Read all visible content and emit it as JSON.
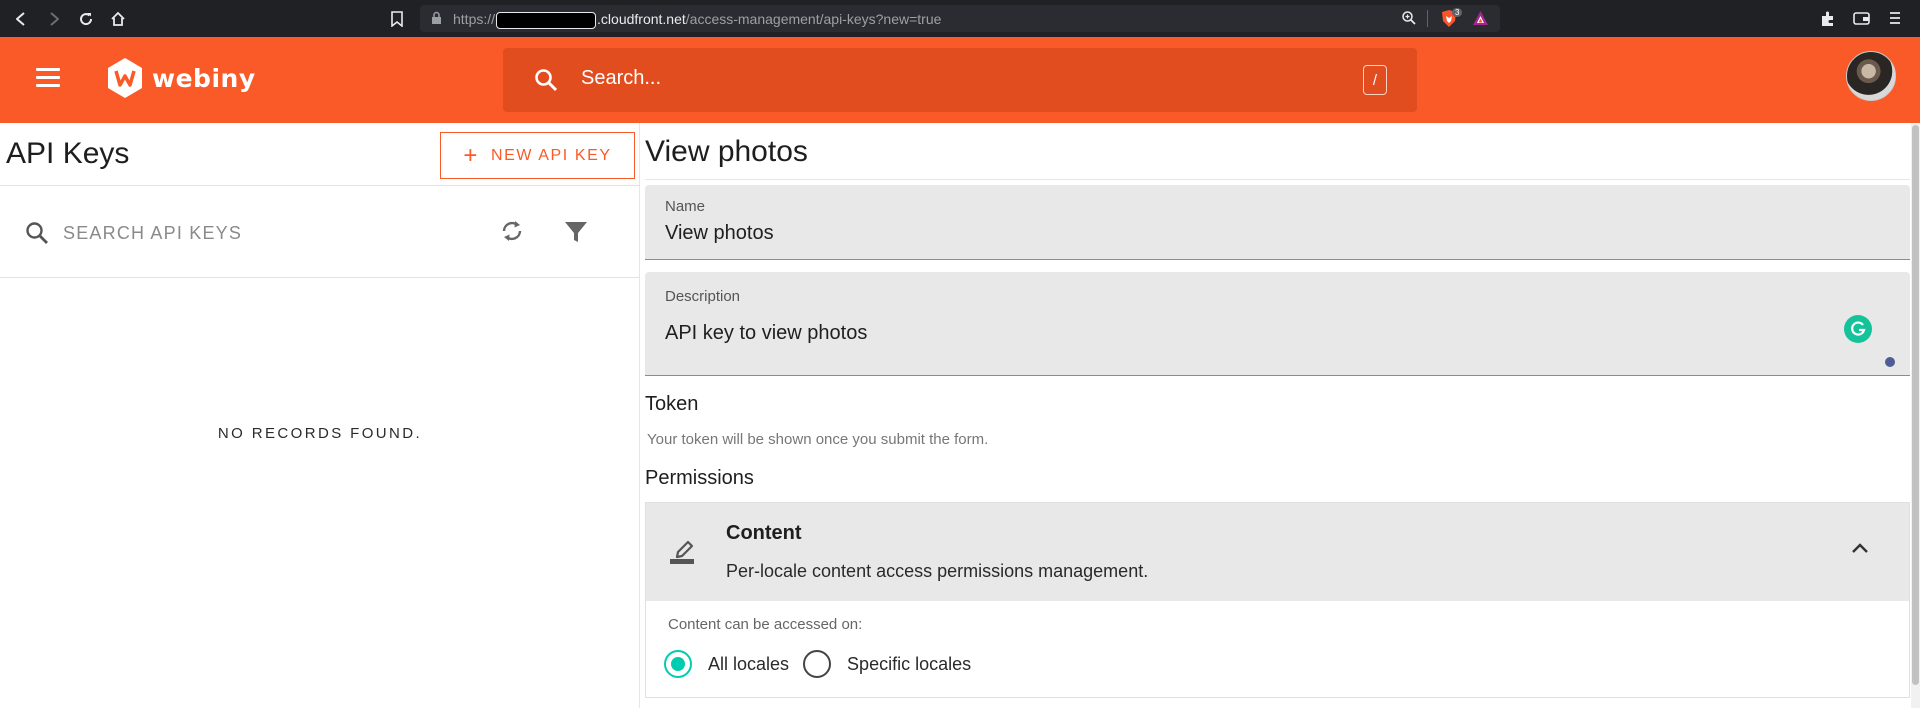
{
  "browser": {
    "url_scheme": "https://",
    "url_host": ".cloudfront.net",
    "url_path": "/access-management/api-keys?new=true",
    "brave_badge": "3"
  },
  "header": {
    "logo_text": "webiny",
    "search_placeholder": "Search...",
    "search_shortcut": "/"
  },
  "list": {
    "title": "API Keys",
    "new_button_label": "NEW API KEY",
    "search_placeholder": "SEARCH API KEYS",
    "empty_text": "NO RECORDS FOUND."
  },
  "form": {
    "title": "View photos",
    "name_label": "Name",
    "name_value": "View photos",
    "description_label": "Description",
    "description_value": "API key to view photos",
    "token_title": "Token",
    "token_help": "Your token will be shown once you submit the form.",
    "permissions_title": "Permissions",
    "permission": {
      "name": "Content",
      "description": "Per-locale content access permissions management.",
      "access_label": "Content can be accessed on:",
      "options": [
        "All locales",
        "Specific locales"
      ],
      "selected": "All locales"
    }
  },
  "colors": {
    "brand": "#fa5a28",
    "accent": "#00ccb0"
  }
}
